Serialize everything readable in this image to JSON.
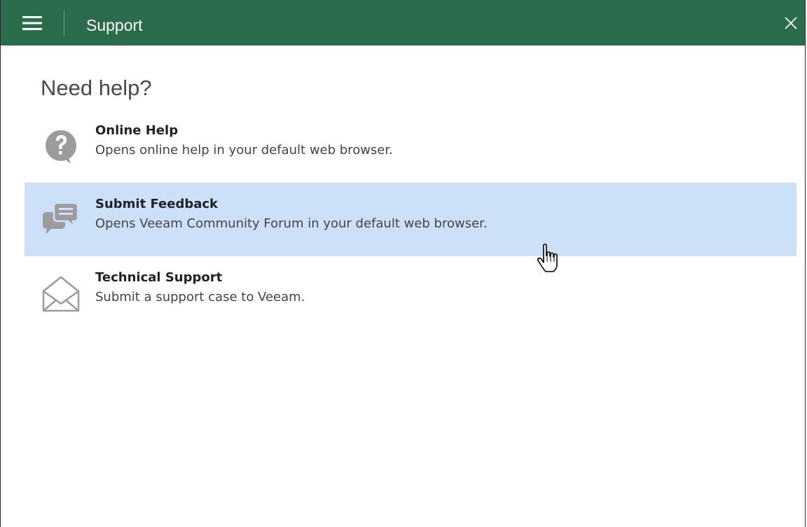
{
  "window": {
    "title": "Support"
  },
  "colors": {
    "titlebar": "#2b6c4c",
    "highlight": "#cce0f8",
    "icon_gray": "#9c9c9c"
  },
  "main": {
    "heading": "Need help?",
    "items": [
      {
        "label": "Online Help",
        "description": "Opens online help in your default web browser.",
        "icon": "question-bubble-icon",
        "highlighted": false
      },
      {
        "label": "Submit Feedback",
        "description": "Opens Veeam Community Forum in your default web browser.",
        "icon": "chat-bubbles-icon",
        "highlighted": true
      },
      {
        "label": "Technical Support",
        "description": "Submit a support case to Veeam.",
        "icon": "envelope-icon",
        "highlighted": false
      }
    ]
  },
  "cursor": {
    "icon": "hand-pointer-cursor-icon"
  }
}
